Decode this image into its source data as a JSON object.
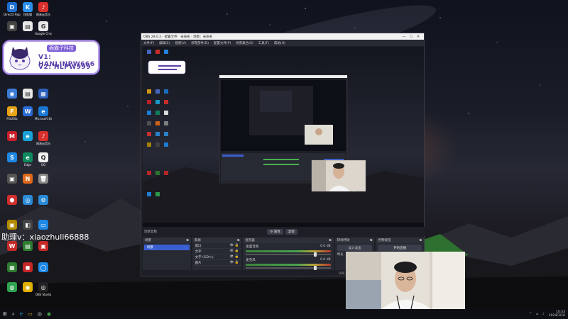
{
  "sticker": {
    "tag": "面霸子科技",
    "line1": "V1: HANLINPW666",
    "line2": "V2: HLPW999"
  },
  "assistant": {
    "text": "助理v：xiaozhuli66888"
  },
  "desktop_icons": [
    {
      "label": "DirectX Repair",
      "color": "#1f6fd1",
      "glyph": "D",
      "icon": "wrench-icon"
    },
    {
      "label": "快剪辑",
      "color": "#2a8ff0",
      "glyph": "K",
      "icon": "app-icon"
    },
    {
      "label": "网易云音乐",
      "color": "#d9302c",
      "glyph": "♪",
      "icon": "music-icon"
    },
    {
      "label": "",
      "color": "#444",
      "glyph": "▣",
      "icon": "app-icon"
    },
    {
      "label": "",
      "color": "#e8e8e8",
      "glyph": "▤",
      "icon": "file-icon"
    },
    {
      "label": "Google Chrome",
      "color": "#e8e8e8",
      "glyph": "G",
      "icon": "chrome-icon"
    },
    {
      "label": "",
      "color": "#3a7bd5",
      "glyph": "◉",
      "icon": "app-icon"
    },
    {
      "label": "",
      "color": "#e8e8e8",
      "glyph": "▤",
      "icon": "file-icon"
    },
    {
      "label": "",
      "color": "#2b5fb8",
      "glyph": "▦",
      "icon": "app-icon"
    },
    {
      "label": "FileZilla",
      "color": "#e8a317",
      "glyph": "F",
      "icon": "ftp-icon"
    },
    {
      "label": "",
      "color": "#2b6bd6",
      "glyph": "W",
      "icon": "word-icon"
    },
    {
      "label": "Microsoft Edge",
      "color": "#1976d2",
      "glyph": "e",
      "icon": "edge-icon"
    },
    {
      "label": "",
      "color": "#c9202a",
      "glyph": "M",
      "icon": "app-icon"
    },
    {
      "label": "",
      "color": "#1aa1d6",
      "glyph": "e",
      "icon": "edge-icon"
    },
    {
      "label": "网易云音乐",
      "color": "#d9302c",
      "glyph": "♪",
      "icon": "music-icon"
    },
    {
      "label": "",
      "color": "#1e88e5",
      "glyph": "S",
      "icon": "app-icon"
    },
    {
      "label": "Edge",
      "color": "#0f8a5f",
      "glyph": "e",
      "icon": "edge-icon"
    },
    {
      "label": "QQ",
      "color": "#f0f0f0",
      "glyph": "Q",
      "icon": "qq-icon"
    },
    {
      "label": "",
      "color": "#555",
      "glyph": "▣",
      "icon": "app-icon"
    },
    {
      "label": "",
      "color": "#e06a1b",
      "glyph": "N",
      "icon": "app-icon"
    },
    {
      "label": "",
      "color": "#888",
      "glyph": "🗑",
      "icon": "recycle-bin-icon"
    },
    {
      "label": "",
      "color": "#d32f2f",
      "glyph": "⬢",
      "icon": "app-icon"
    },
    {
      "label": "",
      "color": "#2b8ad6",
      "glyph": "◎",
      "icon": "app-icon"
    },
    {
      "label": "",
      "color": "#2b8ad6",
      "glyph": "⚙",
      "icon": "settings-icon"
    },
    {
      "label": "",
      "color": "#b38b00",
      "glyph": "▣",
      "icon": "app-icon"
    },
    {
      "label": "",
      "color": "#444",
      "glyph": "◧",
      "icon": "app-icon"
    },
    {
      "label": "",
      "color": "#1e88e5",
      "glyph": "▭",
      "icon": "monitor-icon"
    },
    {
      "label": "",
      "color": "#c62828",
      "glyph": "W",
      "icon": "app-icon"
    },
    {
      "label": "",
      "color": "#2e7d32",
      "glyph": "▤",
      "icon": "app-icon"
    },
    {
      "label": "",
      "color": "#c62828",
      "glyph": "▣",
      "icon": "app-icon"
    },
    {
      "label": "",
      "color": "#2e7d32",
      "glyph": "▦",
      "icon": "app-icon"
    },
    {
      "label": "",
      "color": "#c62828",
      "glyph": "◼",
      "icon": "app-icon"
    },
    {
      "label": "",
      "color": "#1e88e5",
      "glyph": "◯",
      "icon": "app-icon"
    },
    {
      "label": "",
      "color": "#2ea44f",
      "glyph": "◍",
      "icon": "wechat-icon"
    },
    {
      "label": "",
      "color": "#e0b000",
      "glyph": "◉",
      "icon": "app-icon"
    },
    {
      "label": "OBS Studio",
      "color": "#222",
      "glyph": "◎",
      "icon": "obs-icon"
    }
  ],
  "obs": {
    "title": "OBS 29.0.2 - 配置文件：未命名 - 场景：未命名",
    "menu": [
      "文件(F)",
      "编辑(E)",
      "视图(V)",
      "停靠部件(D)",
      "配置文件(P)",
      "场景集合(S)",
      "工具(T)",
      "帮助(H)"
    ],
    "preview_label": "场景音频",
    "preview_buttons": [
      "⚙ 属性",
      "滤镜"
    ],
    "docks": {
      "scenes": {
        "title": "场景",
        "items": [
          "场景"
        ]
      },
      "sources": {
        "title": "来源",
        "items": [
          "窗口",
          "文字",
          "文字 (GDI+)",
          "图片",
          "视频采集设备",
          "显示器采集",
          "窗口采集"
        ]
      },
      "mixer": {
        "title": "混音器",
        "channels": [
          {
            "name": "桌面音频",
            "db": "0.0 dB"
          },
          {
            "name": "麦克风",
            "db": "0.0 dB"
          }
        ]
      },
      "transitions": {
        "title": "转场特效",
        "type": "淡入淡出",
        "duration_label": "时长",
        "duration": "300 ms"
      },
      "controls": {
        "title": "控制按钮",
        "buttons": [
          "开始直播",
          "停止录制",
          "启动虚拟摄像机",
          "工作室模式",
          "设置",
          "退出"
        ]
      }
    },
    "status": {
      "live": "LIVE: 00:00:00",
      "rec": "REC: 00:00:00",
      "cpu": "CPU: 2.1%, 60.00 fps"
    }
  },
  "taskbar": {
    "icons": [
      "windows-icon",
      "search-icon",
      "edge-icon",
      "folder-icon",
      "obs-icon",
      "chrome-icon"
    ],
    "time": "10:33",
    "date": "2024/1/16"
  },
  "colors": {
    "obs_bg": "#1e1f26",
    "accent_blue": "#3a5fd0",
    "sticker_purple": "#7b5cd6"
  }
}
